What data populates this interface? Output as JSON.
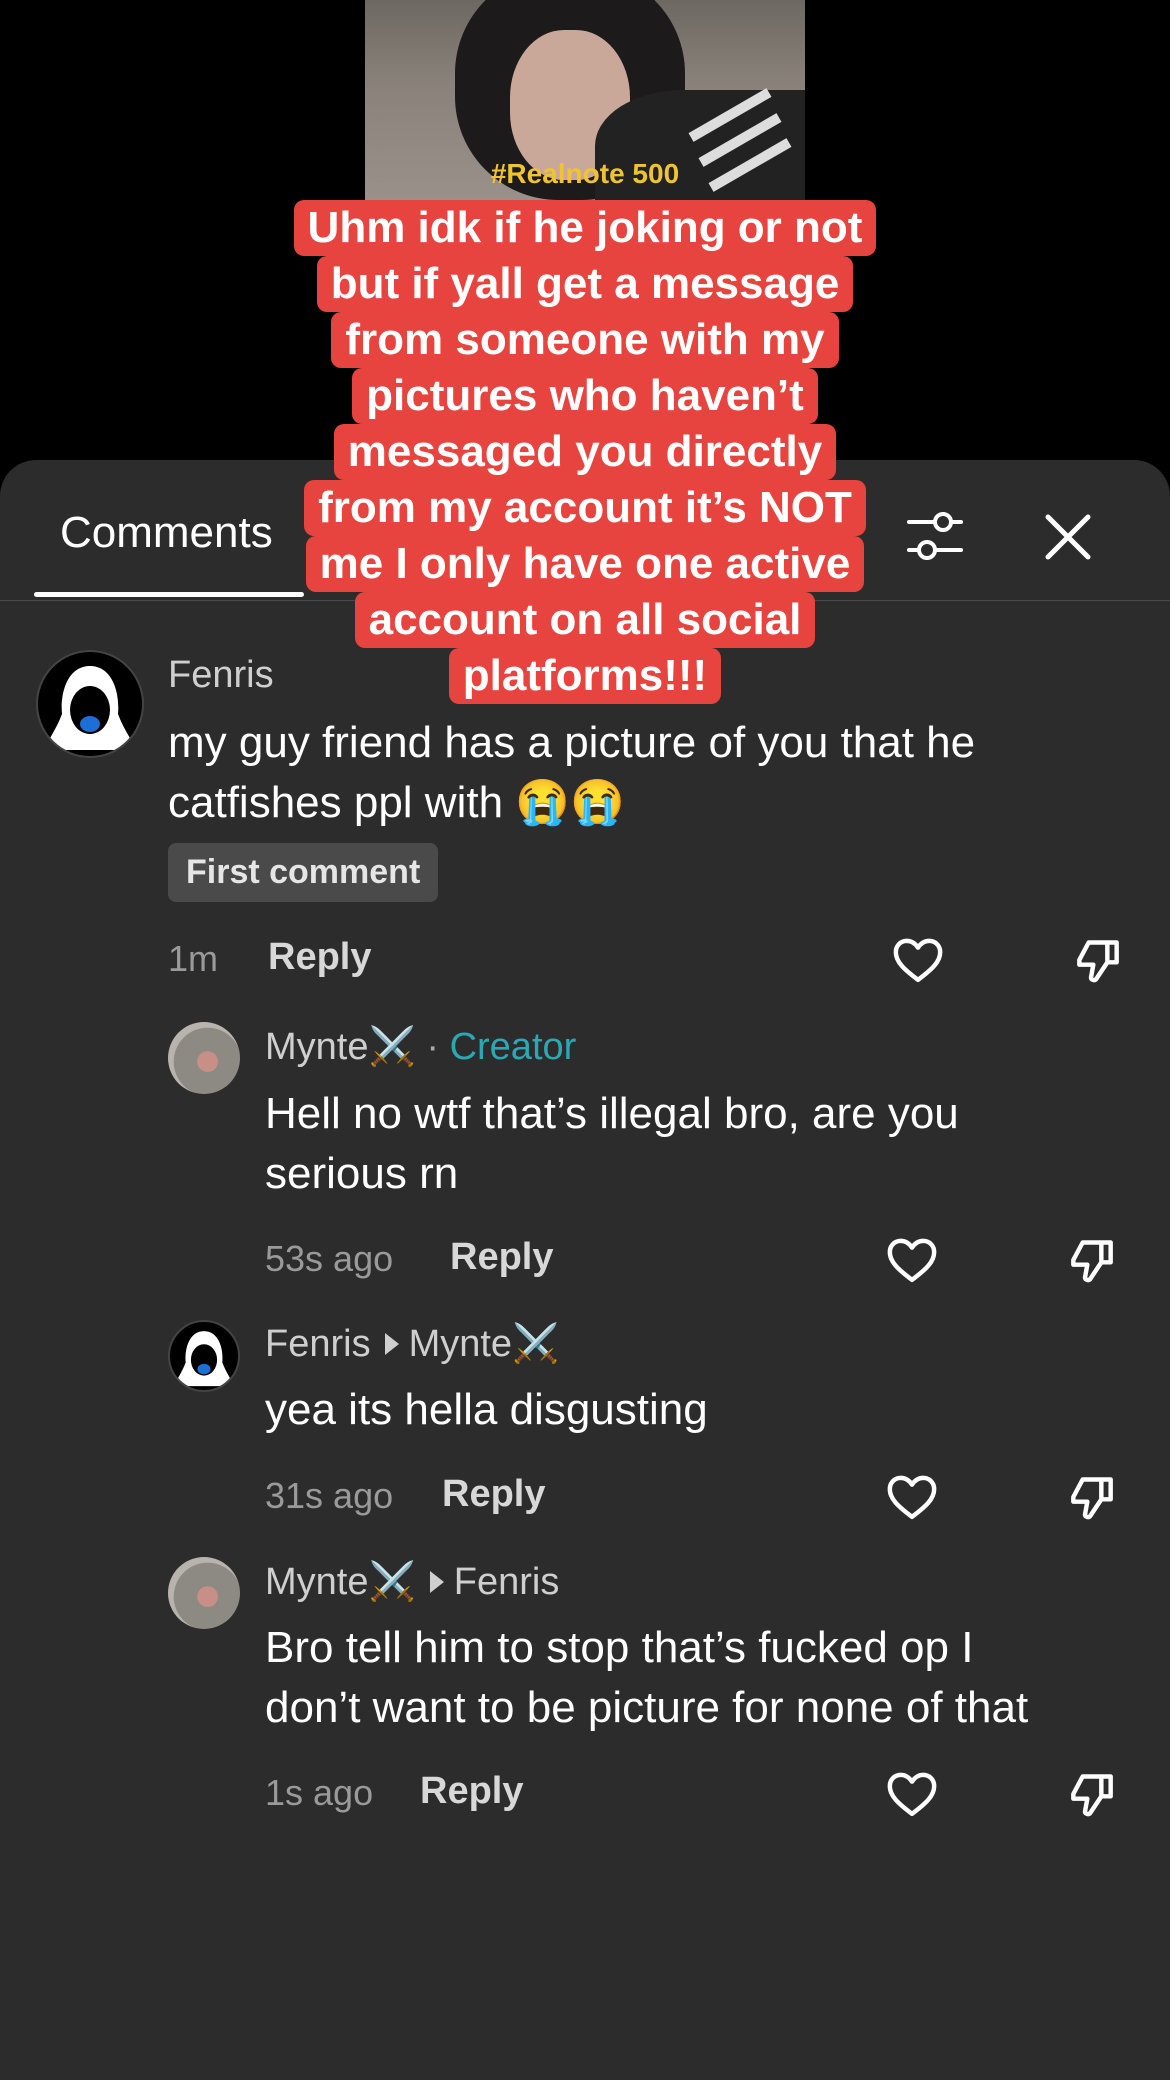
{
  "video": {
    "hashtag": "#Realnote 500",
    "caption_lines": [
      "Uhm idk if he joking or not",
      "but if yall get a message",
      "from someone with my",
      "pictures who haven’t",
      "messaged you directly",
      "from my account it’s NOT",
      "me I only have one active",
      "account on all social",
      "platforms!!!"
    ]
  },
  "sheet": {
    "tab_label": "Comments",
    "icons": {
      "filter": "sliders-icon",
      "close": "close-icon"
    }
  },
  "comments": [
    {
      "username": "Fenris",
      "text_lines": [
        "my guy friend has a picture of you that he",
        "catfishes ppl with 😭😭"
      ],
      "badge": "First comment",
      "time": "1m",
      "reply_label": "Reply"
    },
    {
      "username": "Mynte⚔️",
      "separator": "·",
      "role": "Creator",
      "text_lines": [
        "Hell no wtf that’s illegal bro, are you",
        "serious rn"
      ],
      "time": "53s ago",
      "reply_label": "Reply"
    },
    {
      "username": "Fenris",
      "reply_to": "Mynte⚔️",
      "text_lines": [
        "yea its hella disgusting"
      ],
      "time": "31s ago",
      "reply_label": "Reply"
    },
    {
      "username": "Mynte⚔️",
      "reply_to": "Fenris",
      "text_lines": [
        "Bro tell him to stop that’s fucked op I",
        "don’t want to be picture for none of that"
      ],
      "time": "1s ago",
      "reply_label": "Reply"
    }
  ],
  "colors": {
    "sheet_bg": "#2c2c2c",
    "caption_bg": "#e8443f",
    "creator": "#2aa9b5",
    "hashtag": "#f0c430"
  }
}
